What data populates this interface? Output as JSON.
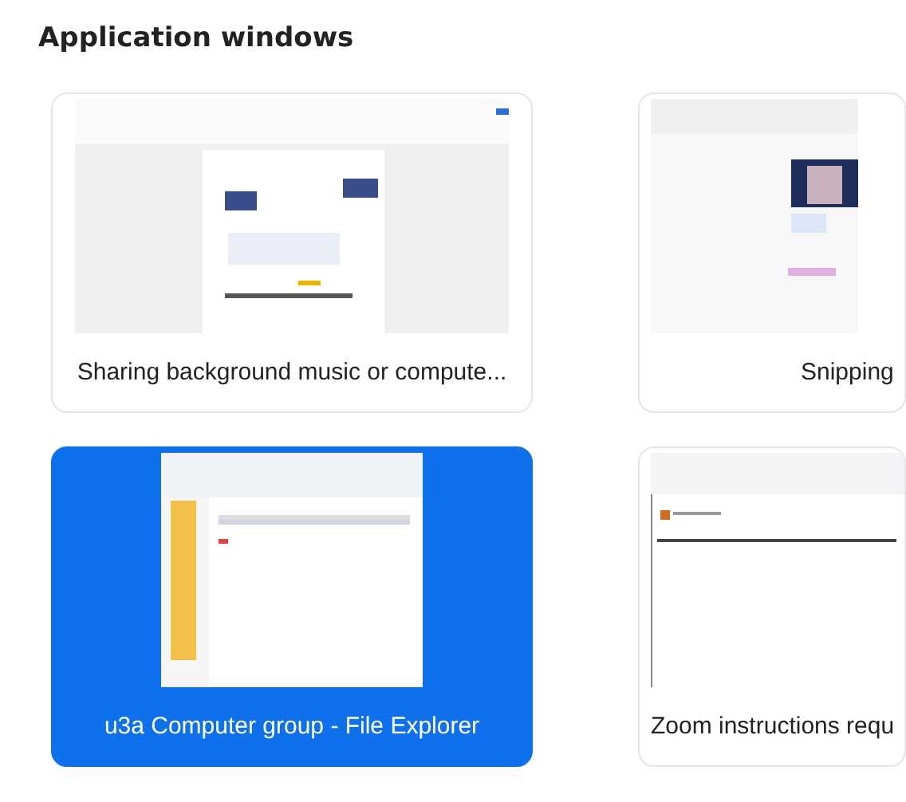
{
  "section": {
    "title": "Application windows"
  },
  "windows": [
    {
      "title": "Sharing background music or compute...",
      "selected": false,
      "kind": "document"
    },
    {
      "title": "Snipping",
      "selected": false,
      "kind": "editor"
    },
    {
      "title": "u3a Computer group - File Explorer",
      "selected": true,
      "kind": "explorer"
    },
    {
      "title": "Zoom instructions requ",
      "selected": false,
      "kind": "mail"
    }
  ]
}
